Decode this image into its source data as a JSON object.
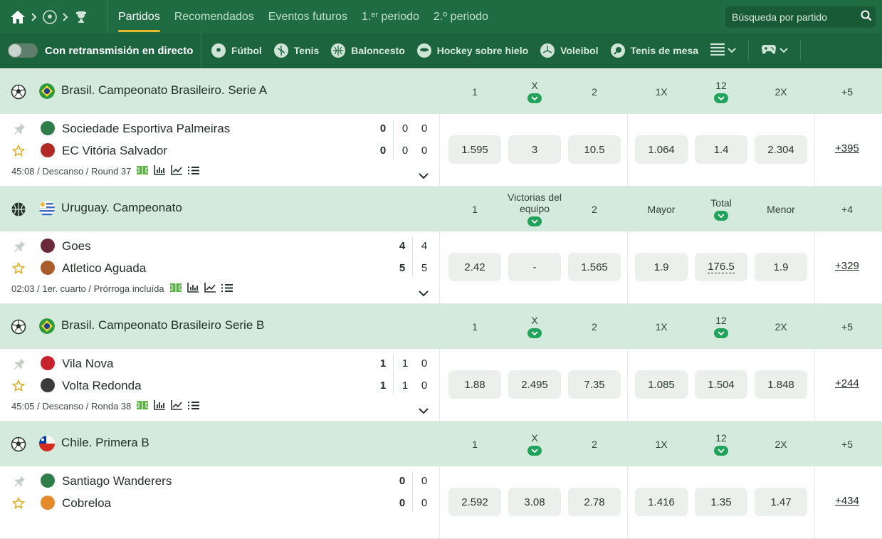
{
  "topbar": {
    "tabs": [
      "Partidos",
      "Recomendados",
      "Eventos futuros",
      "1.ᵉʳ periodo",
      "2.º periodo"
    ],
    "active_tab": 0,
    "search_placeholder": "Búsqueda por partido"
  },
  "sportbar": {
    "live_label": "Con retransmisión en directo",
    "sports": [
      "Fútbol",
      "Tenis",
      "Baloncesto",
      "Hockey sobre hielo",
      "Voleibol",
      "Tenis de mesa"
    ]
  },
  "leagues": [
    {
      "name": "Brasil. Campeonato Brasileiro. Serie A",
      "sport_icon": "soccer-ball-icon",
      "flag": "brazil",
      "cols": [
        "1",
        "X",
        "2",
        "1X",
        "12",
        "2X",
        "+5"
      ],
      "match": {
        "team1": "Sociedade Esportiva Palmeiras",
        "team2": "EC Vitória Salvador",
        "scores1": [
          "0",
          "0",
          "0"
        ],
        "scores2": [
          "0",
          "0",
          "0"
        ],
        "info": "45:08 / Descanso / Round 37",
        "odds": [
          "1.595",
          "3",
          "10.5",
          "1.064",
          "1.4",
          "2.304"
        ],
        "more": "+395"
      }
    },
    {
      "name": "Uruguay. Campeonato",
      "sport_icon": "basketball-icon",
      "flag": "uruguay",
      "cols": [
        "1",
        "Victorias del equipo",
        "2",
        "Mayor",
        "Total",
        "Menor",
        "+4"
      ],
      "match": {
        "team1": "Goes",
        "team2": "Atletico Aguada",
        "scores1": [
          "4",
          "4"
        ],
        "scores2": [
          "5",
          "5"
        ],
        "info": "02:03 / 1er. cuarto / Prórroga incluída",
        "odds": [
          "2.42",
          "-",
          "1.565",
          "1.9",
          "176.5",
          "1.9"
        ],
        "more": "+329"
      }
    },
    {
      "name": "Brasil. Campeonato Brasileiro Serie B",
      "sport_icon": "soccer-ball-icon",
      "flag": "brazil",
      "cols": [
        "1",
        "X",
        "2",
        "1X",
        "12",
        "2X",
        "+5"
      ],
      "match": {
        "team1": "Vila Nova",
        "team2": "Volta Redonda",
        "scores1": [
          "1",
          "1",
          "0"
        ],
        "scores2": [
          "1",
          "1",
          "0"
        ],
        "info": "45:05 / Descanso / Ronda 38",
        "odds": [
          "1.88",
          "2.495",
          "7.35",
          "1.085",
          "1.504",
          "1.848"
        ],
        "more": "+244"
      }
    },
    {
      "name": "Chile. Primera B",
      "sport_icon": "soccer-ball-icon",
      "flag": "chile",
      "cols": [
        "1",
        "X",
        "2",
        "1X",
        "12",
        "2X",
        "+5"
      ],
      "match": {
        "team1": "Santiago Wanderers",
        "team2": "Cobreloa",
        "scores1": [
          "0",
          "0"
        ],
        "scores2": [
          "0",
          "0"
        ],
        "info": "",
        "odds": [
          "2.592",
          "3.08",
          "2.78",
          "1.416",
          "1.35",
          "1.47"
        ],
        "more": "+434"
      }
    }
  ],
  "colors": {
    "header": "#1f6b42",
    "league_bg": "#d4eadc",
    "accent": "#e8b829",
    "chevron": "#22a35b"
  }
}
